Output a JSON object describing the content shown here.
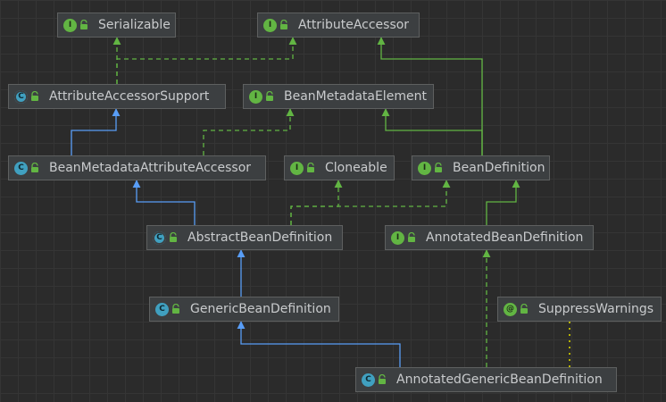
{
  "colors": {
    "background": "#2b2b2b",
    "node_fill": "#3c3f41",
    "node_border": "#5e6060",
    "node_text": "#c9cbcd",
    "interface_badge": "#62b543",
    "class_badge": "#40a0c0",
    "implements_edge": "#62b543",
    "extends_edge": "#589df6",
    "annotation_edge": "#b5b200"
  },
  "nodes": [
    {
      "id": "serializable",
      "kind": "interface",
      "badge": "I",
      "name": "Serializable"
    },
    {
      "id": "attribute-accessor",
      "kind": "interface",
      "badge": "I",
      "name": "AttributeAccessor"
    },
    {
      "id": "attribute-accessor-support",
      "kind": "abstract-class",
      "badge": "C",
      "name": "AttributeAccessorSupport"
    },
    {
      "id": "bean-metadata-element",
      "kind": "interface",
      "badge": "I",
      "name": "BeanMetadataElement"
    },
    {
      "id": "bean-metadata-attribute-accessor",
      "kind": "class",
      "badge": "C",
      "name": "BeanMetadataAttributeAccessor"
    },
    {
      "id": "cloneable",
      "kind": "interface",
      "badge": "I",
      "name": "Cloneable"
    },
    {
      "id": "bean-definition",
      "kind": "interface",
      "badge": "I",
      "name": "BeanDefinition"
    },
    {
      "id": "abstract-bean-definition",
      "kind": "abstract-class",
      "badge": "C",
      "name": "AbstractBeanDefinition"
    },
    {
      "id": "annotated-bean-definition",
      "kind": "interface",
      "badge": "I",
      "name": "AnnotatedBeanDefinition"
    },
    {
      "id": "generic-bean-definition",
      "kind": "class",
      "badge": "C",
      "name": "GenericBeanDefinition"
    },
    {
      "id": "suppress-warnings",
      "kind": "annotation",
      "badge": "@",
      "name": "SuppressWarnings"
    },
    {
      "id": "annotated-generic-bean-definition",
      "kind": "class",
      "badge": "C",
      "name": "AnnotatedGenericBeanDefinition"
    }
  ],
  "edges": [
    {
      "from": "attribute-accessor-support",
      "to": "serializable",
      "type": "implements"
    },
    {
      "from": "attribute-accessor-support",
      "to": "attribute-accessor",
      "type": "implements"
    },
    {
      "from": "bean-definition",
      "to": "attribute-accessor",
      "type": "extends-interface"
    },
    {
      "from": "bean-definition",
      "to": "bean-metadata-element",
      "type": "extends-interface"
    },
    {
      "from": "bean-metadata-attribute-accessor",
      "to": "attribute-accessor-support",
      "type": "extends"
    },
    {
      "from": "bean-metadata-attribute-accessor",
      "to": "bean-metadata-element",
      "type": "implements"
    },
    {
      "from": "abstract-bean-definition",
      "to": "bean-metadata-attribute-accessor",
      "type": "extends"
    },
    {
      "from": "abstract-bean-definition",
      "to": "cloneable",
      "type": "implements"
    },
    {
      "from": "abstract-bean-definition",
      "to": "bean-definition",
      "type": "implements"
    },
    {
      "from": "annotated-bean-definition",
      "to": "bean-definition",
      "type": "extends-interface"
    },
    {
      "from": "generic-bean-definition",
      "to": "abstract-bean-definition",
      "type": "extends"
    },
    {
      "from": "annotated-generic-bean-definition",
      "to": "generic-bean-definition",
      "type": "extends"
    },
    {
      "from": "annotated-generic-bean-definition",
      "to": "annotated-bean-definition",
      "type": "implements"
    },
    {
      "from": "annotated-generic-bean-definition",
      "to": "suppress-warnings",
      "type": "annotated-with"
    }
  ]
}
